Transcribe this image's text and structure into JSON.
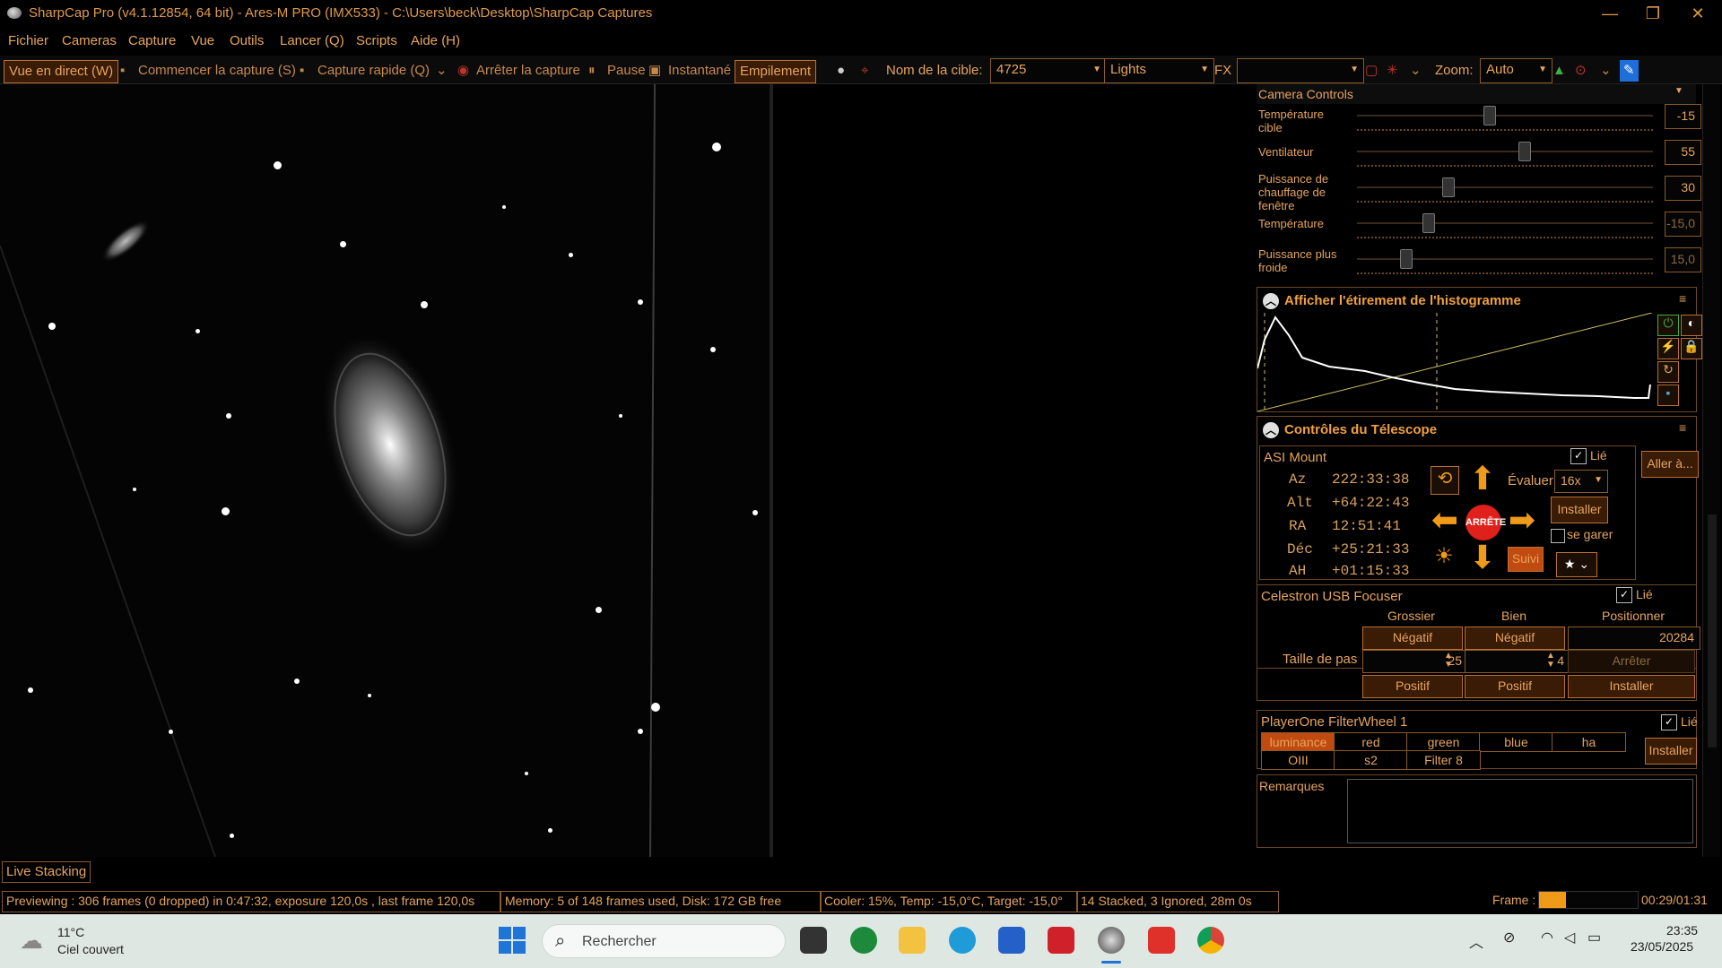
{
  "window": {
    "title": "SharpCap Pro (v4.1.12854, 64 bit) - Ares-M PRO (IMX533) - C:\\Users\\beck\\Desktop\\SharpCap Captures",
    "minimize": "—",
    "maximize": "❐",
    "close": "✕"
  },
  "menu": [
    "Fichier",
    "Cameras",
    "Capture",
    "Vue",
    "Outils",
    "Lancer (Q)",
    "Scripts",
    "Aide (H)"
  ],
  "toolbar": {
    "live_view": "Vue en direct (W)",
    "start_capture": "Commencer la capture (S)",
    "quick_capture": "Capture rapide (Q)",
    "stop_capture": "Arrêter la capture",
    "pause": "Pause",
    "snapshot": "Instantané",
    "stacking": "Empilement",
    "target_label": "Nom de la cible:",
    "target_value": "4725",
    "frame_type": "Lights",
    "fx_label": "FX",
    "fx_value": "",
    "zoom_label": "Zoom:",
    "zoom_value": "Auto"
  },
  "camera_controls": {
    "title": "Camera Controls",
    "rows": [
      {
        "label": "Température cible",
        "value": "-15",
        "level": 0.44
      },
      {
        "label": "Ventilateur",
        "value": "55",
        "level": 0.55
      },
      {
        "label": "Puissance de chauffage de fenêtre",
        "value": "30",
        "level": 0.3
      },
      {
        "label": "Température",
        "value": "-15,0",
        "level": 0.23
      },
      {
        "label": "Puissance plus froide",
        "value": "15,0",
        "level": 0.15
      }
    ]
  },
  "histogram": {
    "title": "Afficher l'étirement de l'histogramme"
  },
  "telescope": {
    "title": "Contrôles du Télescope",
    "mount_name": "ASI Mount",
    "linked_label": "Lié",
    "coords": [
      {
        "label": "Az",
        "value": "222:33:38"
      },
      {
        "label": "Alt",
        "value": "+64:22:43"
      },
      {
        "label": "RA",
        "value": "12:51:41"
      },
      {
        "label": "Déc",
        "value": "+25:21:33"
      },
      {
        "label": "AH",
        "value": "+01:15:33"
      }
    ],
    "stop_label": "ARRÊTE",
    "rate_label": "Évaluer:",
    "rate_value": "16x",
    "goto_button": "Aller à...",
    "setup_button": "Installer",
    "park_label": "se garer",
    "tracking_button": "Suivi"
  },
  "focuser": {
    "title": "Celestron USB Focuser",
    "linked_label": "Lié",
    "col_coarse": "Grossier",
    "col_fine": "Bien",
    "col_position": "Positionner",
    "negative": "Négatif",
    "positive": "Positif",
    "step_label": "Taille de pas",
    "coarse_step": "25",
    "fine_step": "4",
    "position_value": "20284",
    "stop_button": "Arrêter",
    "setup_button": "Installer"
  },
  "filterwheel": {
    "title": "PlayerOne FilterWheel 1",
    "linked_label": "Lié",
    "filters_row1": [
      "luminance",
      "red",
      "green",
      "blue",
      "ha"
    ],
    "filters_row2": [
      "OIII",
      "s2",
      "Filter 8"
    ],
    "selected": "luminance",
    "setup_button": "Installer"
  },
  "notes": {
    "label": "Remarques"
  },
  "live_stacking_tab": "Live Stacking",
  "status": {
    "preview": "Previewing : 306 frames (0 dropped) in 0:47:32, exposure 120,0s , last frame 120,0s",
    "memory": "Memory: 5 of 148 frames used, Disk: 172 GB free",
    "cooler": "Cooler: 15%, Temp: -15,0°C, Target: -15,0°",
    "stacked": "14 Stacked, 3 Ignored, 28m 0s",
    "frame_label": "Frame :",
    "frame_progress": 0.27,
    "frame_time": "00:29/01:31"
  },
  "taskbar": {
    "weather_temp": "11°C",
    "weather_desc": "Ciel couvert",
    "search_placeholder": "Rechercher",
    "time": "23:35",
    "date": "23/05/2025"
  },
  "colors": {
    "accent": "#e6a45d",
    "panel_border": "#8a5a2a",
    "stop_red": "#e0201a",
    "arrow_orange": "#f09a1a"
  }
}
